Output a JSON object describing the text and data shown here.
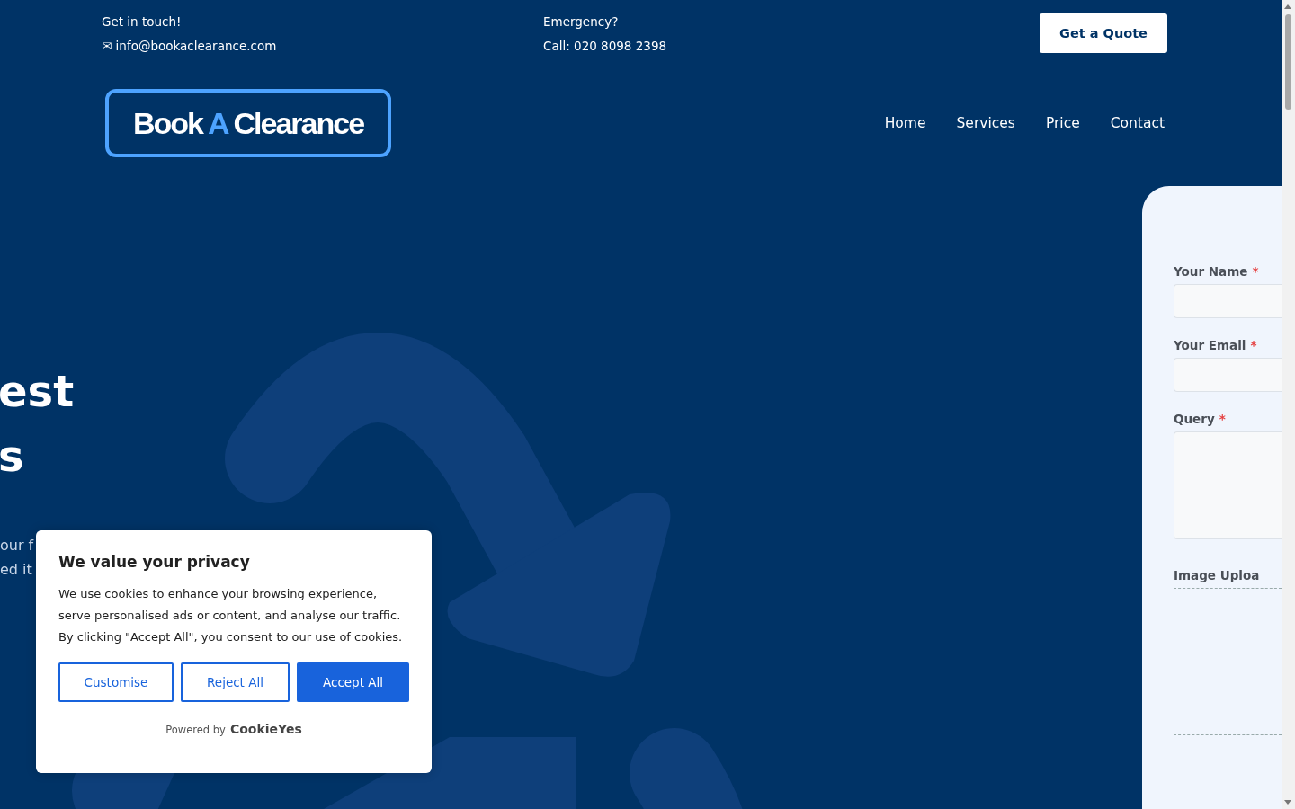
{
  "top_bar": {
    "contact": {
      "title": "Get in touch!",
      "icon": "✉",
      "email": "info@bookaclearance.com"
    },
    "emergency": {
      "title": "Emergency?",
      "phone": "Call: 020 8098 2398"
    },
    "quote_button": "Get a Quote"
  },
  "logo": {
    "parts": [
      {
        "text": "Book",
        "accent": false
      },
      {
        "text": "A",
        "accent": true
      },
      {
        "text": "Clearance",
        "accent": false
      }
    ]
  },
  "nav": [
    "Home",
    "Services",
    "Price",
    "Contact"
  ],
  "hero": {
    "heading_lines": [
      "est",
      "s"
    ],
    "text_lines": [
      "our f",
      "ed it"
    ]
  },
  "form": {
    "required_mark": "*",
    "fields": [
      {
        "label": "Your Name",
        "required": true,
        "kind": "input"
      },
      {
        "label": "Your Email",
        "required": true,
        "kind": "input"
      },
      {
        "label": "Query",
        "required": true,
        "kind": "textarea"
      },
      {
        "label": "Image Uploa",
        "required": false,
        "kind": "upload"
      }
    ]
  },
  "cookie_banner": {
    "title": "We value your privacy",
    "text": "We use cookies to enhance your browsing experience, serve personalised ads or content, and analyse our traffic. By clicking \"Accept All\", you consent to our use of cookies.",
    "buttons": [
      {
        "label": "Customise",
        "kind": "outline"
      },
      {
        "label": "Reject All",
        "kind": "outline"
      },
      {
        "label": "Accept All",
        "kind": "primary"
      }
    ],
    "powered_by": "Powered by",
    "brand": "CookieYes"
  }
}
